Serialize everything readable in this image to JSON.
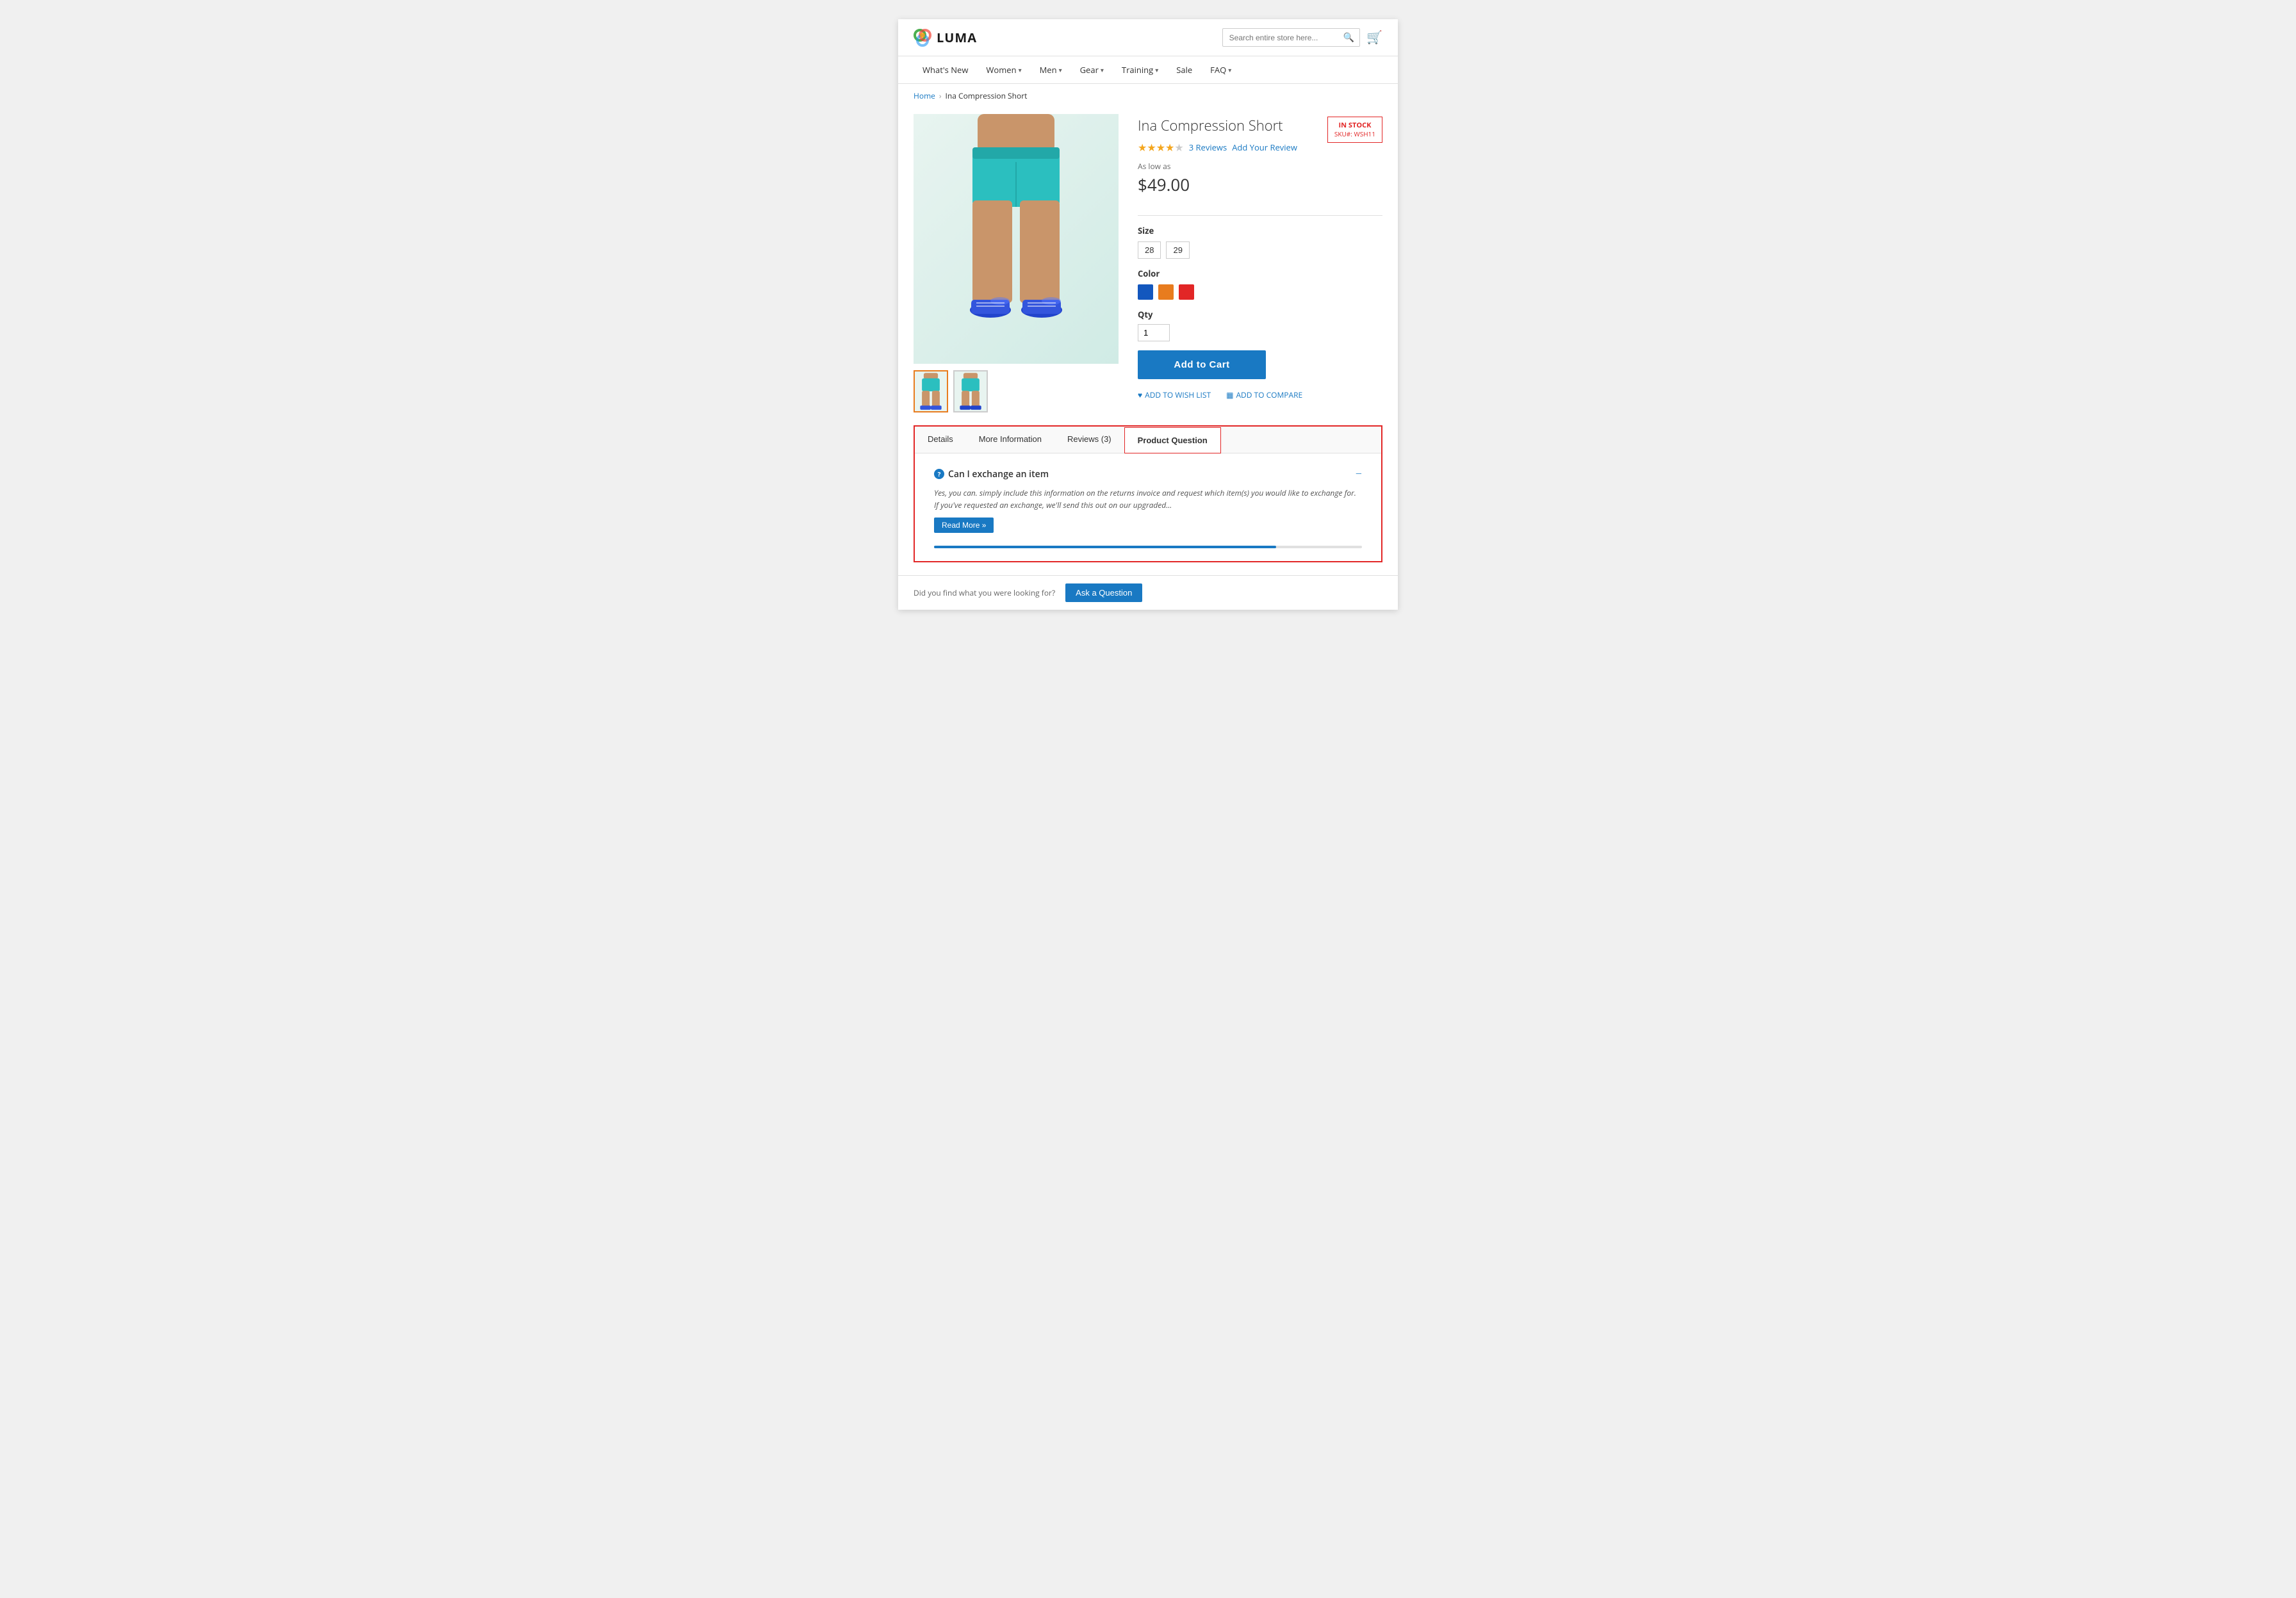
{
  "site": {
    "logo_text": "LUMA",
    "search_placeholder": "Search entire store here..."
  },
  "nav": {
    "items": [
      {
        "label": "What's New",
        "has_dropdown": false
      },
      {
        "label": "Women",
        "has_dropdown": true
      },
      {
        "label": "Men",
        "has_dropdown": true
      },
      {
        "label": "Gear",
        "has_dropdown": true
      },
      {
        "label": "Training",
        "has_dropdown": true
      },
      {
        "label": "Sale",
        "has_dropdown": false
      },
      {
        "label": "FAQ",
        "has_dropdown": true
      }
    ]
  },
  "breadcrumb": {
    "home": "Home",
    "current": "Ina Compression Short"
  },
  "product": {
    "title": "Ina Compression Short",
    "rating_value": 4,
    "rating_max": 5,
    "review_count": "3 Reviews",
    "add_review_label": "Add Your Review",
    "stock_label": "IN STOCK",
    "sku_label": "SKU#: WSH11",
    "as_low_as": "As low as",
    "price": "$49.00",
    "size_label": "Size",
    "sizes": [
      "28",
      "29"
    ],
    "color_label": "Color",
    "colors": [
      "#1357be",
      "#e87c1e",
      "#e22626"
    ],
    "qty_label": "Qty",
    "qty_default": "1",
    "add_to_cart": "Add to Cart",
    "add_to_wishlist": "ADD TO WISH LIST",
    "add_to_compare": "ADD TO COMPARE"
  },
  "tabs": {
    "items": [
      {
        "label": "Details",
        "active": false
      },
      {
        "label": "More Information",
        "active": false
      },
      {
        "label": "Reviews (3)",
        "active": false
      },
      {
        "label": "Product Question",
        "active": true
      }
    ],
    "faq": {
      "question": "Can I exchange an item",
      "answer": "Yes, you can. simply include this information on the returns invoice and request which item(s) you would like to exchange for. If you've requested an exchange, we'll send this out on our upgraded...",
      "read_more": "Read More »",
      "collapse_icon": "−",
      "q_icon": "?"
    },
    "progress_percent": 80
  },
  "footer_bar": {
    "question_text": "Did you find what you were looking for?",
    "ask_button": "Ask a Question"
  }
}
